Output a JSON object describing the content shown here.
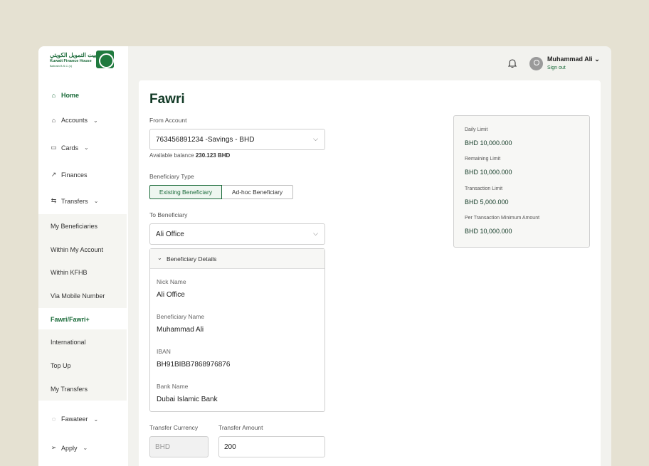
{
  "brand": {
    "arabic": "بيت التمويل الكويتي",
    "english": "Kuwait Finance House",
    "sub": "Bahrain B.S.C (c)"
  },
  "nav": {
    "home": "Home",
    "accounts": "Accounts",
    "cards": "Cards",
    "finances": "Finances",
    "transfers": "Transfers",
    "fawateer": "Fawateer",
    "apply": "Apply"
  },
  "transfers_menu": [
    "My Beneficiaries",
    "Within My Account",
    "Within KFHB",
    "Via Mobile Number",
    "Fawri/Fawri+",
    "International",
    "Top Up",
    "My Transfers"
  ],
  "user": {
    "name": "Muhammad Ali",
    "sign_out": "Sign out"
  },
  "page": {
    "title": "Fawri"
  },
  "form": {
    "from_account_label": "From Account",
    "from_account_value": "763456891234 -Savings - BHD",
    "balance_prefix": "Available balance",
    "balance_value": "230.123 BHD",
    "beneficiary_type_label": "Beneficiary Type",
    "type_existing": "Existing Beneficiary",
    "type_adhoc": "Ad-hoc Beneficiary",
    "to_beneficiary_label": "To Beneficiary",
    "to_beneficiary_value": "Ali Office",
    "details_title": "Beneficiary Details",
    "nick_name_label": "Nick Name",
    "nick_name_value": "Ali Office",
    "ben_name_label": "Beneficiary Name",
    "ben_name_value": "Muhammad Ali",
    "iban_label": "IBAN",
    "iban_value": "BH91BIBB7868976876",
    "bank_label": "Bank Name",
    "bank_value": "Dubai Islamic Bank",
    "currency_label": "Transfer Currency",
    "currency_value": "BHD",
    "amount_label": "Transfer Amount",
    "amount_value": "200"
  },
  "limits": [
    {
      "label": "Daily Limit",
      "value": "BHD 10,000.000"
    },
    {
      "label": "Remaining Limit",
      "value": "BHD 10,000.000"
    },
    {
      "label": "Transaction Limit",
      "value": "BHD 5,000.000"
    },
    {
      "label": "Per Transaction Minimum Amount",
      "value": "BHD 10,000.000"
    }
  ],
  "icons": {
    "home": "home-icon",
    "accounts": "bank-icon",
    "cards": "card-icon",
    "finances": "trend-icon",
    "transfers": "transfer-icon",
    "fawateer": "bill-icon",
    "apply": "send-icon",
    "bell": "bell-icon",
    "user": "user-icon"
  },
  "colors": {
    "brand_green": "#1b6b3a",
    "page_bg": "#e5e1d2"
  }
}
